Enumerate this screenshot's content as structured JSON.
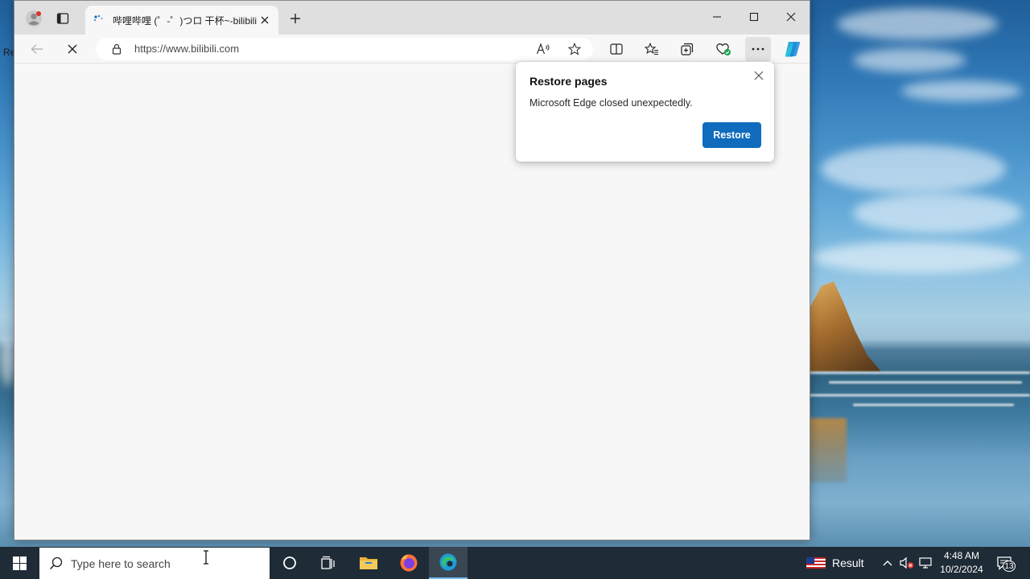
{
  "desktop": {
    "edge_label": "Re"
  },
  "browser": {
    "tab": {
      "title": "哔哩哔哩 (゜-゜)つロ 干杯~-bilibili",
      "loading": true
    },
    "address_bar": {
      "url": "https://www.bilibili.com"
    },
    "colors": {
      "accent": "#0f6cbd",
      "titlebar": "#dfdfdf",
      "page": "#f7f7f7"
    },
    "toolbar_icons": [
      "read-aloud-icon",
      "favorite-star-icon",
      "split-screen-icon",
      "favorites-icon",
      "collections-icon",
      "browser-essentials-icon",
      "more-menu-icon",
      "copilot-icon"
    ]
  },
  "popup": {
    "title": "Restore pages",
    "message": "Microsoft Edge closed unexpectedly.",
    "button_label": "Restore"
  },
  "taskbar": {
    "search_placeholder": "Type here to search",
    "weather_label": "Result",
    "time": "4:48 AM",
    "date": "10/2/2024",
    "notification_count": "13",
    "apps": [
      "cortana-icon",
      "task-view-icon",
      "file-explorer-icon",
      "firefox-icon",
      "edge-icon"
    ]
  }
}
